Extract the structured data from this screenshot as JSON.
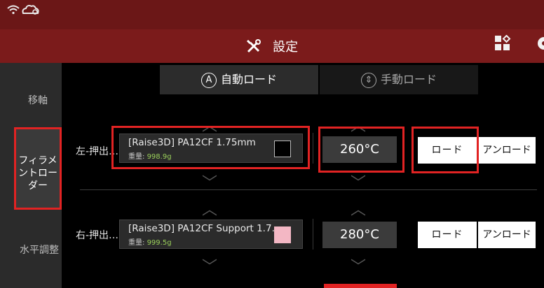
{
  "status": {
    "wifi_icon": "wifi-icon",
    "cloud_icon": "cloud-link-icon"
  },
  "title": "設定",
  "title_icon": "wrench-screwdriver-icon",
  "toolbar_icons": [
    "app-grid-icon",
    "gear-icon"
  ],
  "sidebar": {
    "items": [
      {
        "label": "移軸"
      },
      {
        "label": "フィラメントローダー",
        "lines": [
          "フィラメ",
          "ントロー",
          "ダー"
        ]
      },
      {
        "label": "水平調整"
      }
    ]
  },
  "modes": {
    "auto": "自動ロード",
    "manual": "手動ロード",
    "auto_icon": "A",
    "manual_icon": "⇕"
  },
  "extruders": [
    {
      "label": "左-押出…",
      "material": "[Raise3D] PA12CF 1.75mm",
      "weight_label": "重量:",
      "weight_value": "998.9g",
      "swatch": "#000000",
      "temp": "260°C",
      "load": "ロード",
      "unload": "アンロード"
    },
    {
      "label": "右-押出…",
      "material": "[Raise3D] PA12CF Support 1.7…",
      "weight_label": "重量:",
      "weight_value": "999.5g",
      "swatch": "#f3b7c4",
      "temp": "280°C",
      "load": "ロード",
      "unload": "アンロード"
    }
  ],
  "colors": {
    "header": "#7b1b1b",
    "status": "#6b1717",
    "highlight": "#e12323"
  }
}
